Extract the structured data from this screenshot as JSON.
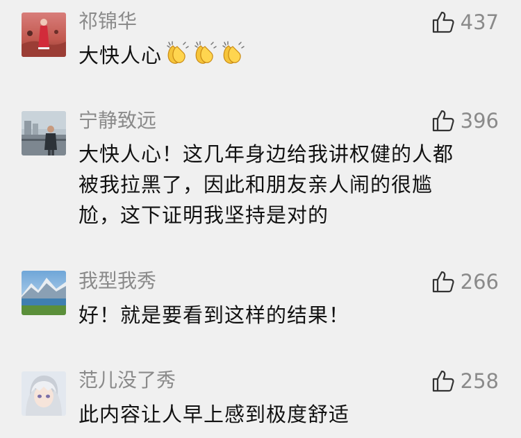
{
  "comments": [
    {
      "author": "祁锦华",
      "likes": "437",
      "lines": [
        "大快人心"
      ],
      "emoji_count": 3,
      "emoji": "clapping-hands-icon"
    },
    {
      "author": "宁静致远",
      "likes": "396",
      "lines": [
        "大快人心！这几年身边给我讲权健的人都",
        "被我拉黑了，因此和朋友亲人闹的很尴",
        "尬，这下证明我坚持是对的"
      ]
    },
    {
      "author": "我型我秀",
      "likes": "266",
      "lines": [
        "好！就是要看到这样的结果！"
      ]
    },
    {
      "author": "范儿没了秀",
      "likes": "258",
      "lines": [
        "此内容让人早上感到极度舒适"
      ]
    }
  ],
  "colors": {
    "background": "#f0f0f0",
    "meta_text": "#8a8a8a",
    "body_text": "#111111",
    "like_icon": "#333333"
  },
  "icons": {
    "like": "thumbs-up-icon",
    "emoji": "clapping-hands-icon"
  }
}
